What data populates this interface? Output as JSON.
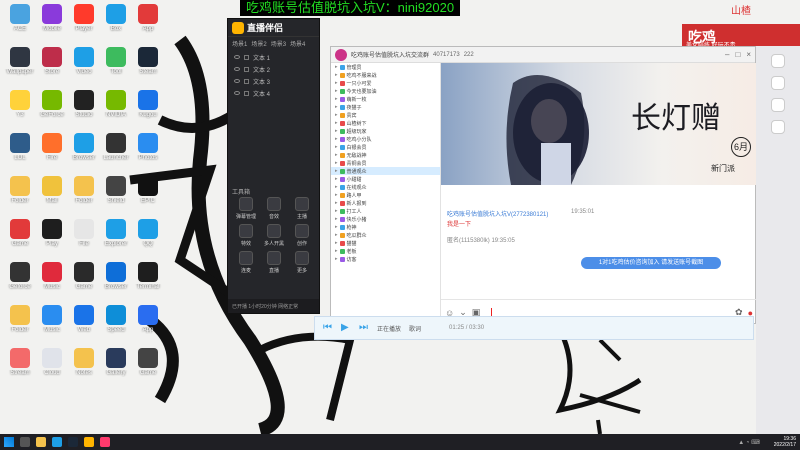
{
  "banner": {
    "text": "吃鸡账号估值脱坑入坑V：nini92020"
  },
  "shop": {
    "name": "山楂",
    "title": "吃鸡",
    "subtitle": "美女陪练 好玩不贵"
  },
  "desktop_icons": [
    {
      "label": "ACE",
      "color": "#4aa3e0"
    },
    {
      "label": "Wallpaper",
      "color": "#2f3642"
    },
    {
      "label": "Y3",
      "color": "#ffd23a"
    },
    {
      "label": "LOL",
      "color": "#2e5c8a"
    },
    {
      "label": "Folder",
      "color": "#f4c24d"
    },
    {
      "label": "Game",
      "color": "#e23a3a"
    },
    {
      "label": "Geforce",
      "color": "#333333"
    },
    {
      "label": "Folder",
      "color": "#f4c24d"
    },
    {
      "label": "Stream",
      "color": "#f36a6a"
    },
    {
      "label": "Mobile",
      "color": "#8a3adb"
    },
    {
      "label": "Store",
      "color": "#be2d4a"
    },
    {
      "label": "GeForce",
      "color": "#76b900"
    },
    {
      "label": "Fire",
      "color": "#ff6f2b"
    },
    {
      "label": "Mail",
      "color": "#f0c23c"
    },
    {
      "label": "Play",
      "color": "#1e1e1e"
    },
    {
      "label": "Music",
      "color": "#e02a3c"
    },
    {
      "label": "Music",
      "color": "#2a8df0"
    },
    {
      "label": "Cloud",
      "color": "#e0e3ea"
    },
    {
      "label": "Player",
      "color": "#ff3a2b"
    },
    {
      "label": "Video",
      "color": "#1e9fe6"
    },
    {
      "label": "Studio",
      "color": "#222222"
    },
    {
      "label": "Browser",
      "color": "#1e9fe6"
    },
    {
      "label": "Folder",
      "color": "#f4c24d"
    },
    {
      "label": "File",
      "color": "#e6e6e6"
    },
    {
      "label": "Game",
      "color": "#2a2a2a"
    },
    {
      "label": "Web",
      "color": "#1a73e8"
    },
    {
      "label": "Notes",
      "color": "#f4c24d"
    },
    {
      "label": "Box",
      "color": "#1e9fe6"
    },
    {
      "label": "Tool",
      "color": "#3dbb5e"
    },
    {
      "label": "NVIDIA",
      "color": "#76b900"
    },
    {
      "label": "Launcher",
      "color": "#333333"
    },
    {
      "label": "Shield",
      "color": "#444444"
    },
    {
      "label": "Explorer",
      "color": "#1e9fe6"
    },
    {
      "label": "Browser",
      "color": "#0e6ed8"
    },
    {
      "label": "Speed",
      "color": "#0e8ed8"
    },
    {
      "label": "Gallery",
      "color": "#2a3b5c"
    },
    {
      "label": "App",
      "color": "#e23a3a"
    },
    {
      "label": "Steam",
      "color": "#1b2838"
    },
    {
      "label": "Kugou",
      "color": "#1a73e8"
    },
    {
      "label": "Photos",
      "color": "#2a8df0"
    },
    {
      "label": "EPIC",
      "color": "#111111"
    },
    {
      "label": "QQ",
      "color": "#1e9fe6"
    },
    {
      "label": "Terminal",
      "color": "#1e1e1e"
    },
    {
      "label": "App",
      "color": "#2a6df0"
    },
    {
      "label": "Game",
      "color": "#444444"
    }
  ],
  "companion": {
    "title": "直播伴侣",
    "tabs": [
      "场景1",
      "场景2",
      "场景3",
      "场景4"
    ],
    "scenes": [
      "文本 1",
      "文本 2",
      "文本 3",
      "文本 4"
    ],
    "section_label": "工具箱",
    "tools": [
      "弹幕管理",
      "音效",
      "主播",
      "特效",
      "多人开黑",
      "创作",
      "连麦",
      "直播",
      "更多"
    ],
    "footer": "已开播 1小时20分钟 网络正常"
  },
  "room": {
    "title": "吃鸡账号估值脱坑入坑交流群",
    "id": "40717173",
    "online": "222",
    "side_items": [
      {
        "text": "管理员",
        "selected": false
      },
      {
        "text": "吃鸡不服来战",
        "selected": false
      },
      {
        "text": "一只小可爱",
        "selected": false
      },
      {
        "text": "今天也要加油",
        "selected": false
      },
      {
        "text": "萌新一枚",
        "selected": false
      },
      {
        "text": "夜猫子",
        "selected": false
      },
      {
        "text": "贵宾",
        "selected": false
      },
      {
        "text": "山楂树下",
        "selected": false
      },
      {
        "text": "超级玩家",
        "selected": false
      },
      {
        "text": "吃鸡小分队",
        "selected": false
      },
      {
        "text": "白银会员",
        "selected": false
      },
      {
        "text": "无敌战神",
        "selected": false
      },
      {
        "text": "青铜会员",
        "selected": false
      },
      {
        "text": "普通观众",
        "selected": true
      },
      {
        "text": "小甜甜",
        "selected": false
      },
      {
        "text": "在线观众",
        "selected": false
      },
      {
        "text": "路人甲",
        "selected": false
      },
      {
        "text": "新人报到",
        "selected": false
      },
      {
        "text": "打工人",
        "selected": false
      },
      {
        "text": "快乐小猪",
        "selected": false
      },
      {
        "text": "枪神",
        "selected": false
      },
      {
        "text": "吃瓜群众",
        "selected": false
      },
      {
        "text": "猫猫",
        "selected": false
      },
      {
        "text": "老板",
        "selected": false
      },
      {
        "text": "访客",
        "selected": false
      }
    ],
    "banner_title": "长灯赠",
    "banner_date": "6月",
    "banner_sub": "新门派",
    "chat_user": "吃鸡账号估值脱坑入坑V(2772380121)",
    "chat_time": "19:35:01",
    "chat_msg": "我是一下",
    "chat_line2": "匿名(1115380lk) 19:35:05",
    "chat_bubble": "1对1吃鸡估价咨询加入 请发送账号截图"
  },
  "player": {
    "time": "01:25 / 03:30",
    "text": "正在播放",
    "label": "歌词"
  },
  "clock": {
    "time": "19:36",
    "date": "2022/2/17"
  },
  "colors": {
    "accent": "#4c8ee8",
    "banner_green": "#22dd22",
    "brand_red": "#cf2f2f"
  }
}
